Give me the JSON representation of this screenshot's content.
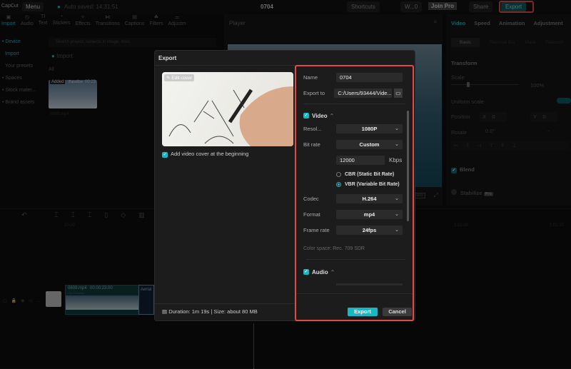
{
  "app": {
    "logo": "CapCut",
    "menu": "Menu",
    "autosave": "Auto saved: 14:31:51",
    "project_title": "0704",
    "shortcuts": "Shortcuts",
    "workspace": "W...0",
    "join_pro": "Join Pro",
    "share": "Share",
    "export": "Export"
  },
  "toolbar": [
    {
      "label": "Import",
      "icon": "import-icon"
    },
    {
      "label": "Audio",
      "icon": "audio-icon"
    },
    {
      "label": "Text",
      "icon": "text-icon"
    },
    {
      "label": "Stickers",
      "icon": "stickers-icon"
    },
    {
      "label": "Effects",
      "icon": "effects-icon"
    },
    {
      "label": "Transitions",
      "icon": "transitions-icon"
    },
    {
      "label": "Captions",
      "icon": "captions-icon"
    },
    {
      "label": "Filters",
      "icon": "filters-icon"
    },
    {
      "label": "Adjustm",
      "icon": "adjust-icon"
    }
  ],
  "sidebar": {
    "items": [
      "• Device",
      "Import",
      "Your presets",
      "• Spaces",
      "• Stock mater...",
      "• Brand assets"
    ]
  },
  "media": {
    "search_placeholder": "Search project, subjects in image, lines",
    "import": "Import",
    "filter": "All",
    "clip_badge": "Added",
    "clip_title": "Paradise",
    "clip_duration": "00:23",
    "clip_name": "0609.mp4"
  },
  "player": {
    "title": "Player",
    "ratio": "Ratio"
  },
  "right_panel": {
    "tabs": [
      "Video",
      "Speed",
      "Animation",
      "Adjustment"
    ],
    "subtabs": [
      "Basic",
      "Remove BG",
      "Mask",
      "Retouch"
    ],
    "transform": "Transform",
    "scale": "Scale",
    "scale_value": "100%",
    "scale_fraction": 0.1,
    "uniform_scale": "Uniform scale",
    "position": "Position",
    "pos_x_label": "X",
    "pos_x": "0",
    "pos_y_label": "Y",
    "pos_y": "0",
    "rotate": "Rotate",
    "rotate_value": "0.0°",
    "rotate_extra": "-",
    "blend": "Blend",
    "stabilize": "Stabilize",
    "pro_badge": "Pro"
  },
  "timeline": {
    "ticks": [
      "00:00",
      "1:02:00",
      "1:02:30"
    ],
    "clip1_name": "0609.mp4",
    "clip1_duration": "00:00:23:00",
    "clip1_sub": "Sky Paradise",
    "clip2_name": "Aerial"
  },
  "export_dialog": {
    "title": "Export",
    "edit_cover": "Edit cover",
    "add_cover": "Add video cover at the beginning",
    "name_label": "Name",
    "name_value": "0704",
    "export_to_label": "Export to",
    "export_to_value": "C:/Users/93444/Vide...",
    "video_section": "Video",
    "resolution_label": "Resol...",
    "resolution": "1080P",
    "bitrate_label": "Bit rate",
    "bitrate": "Custom",
    "kbps_value": "12000",
    "kbps_unit": "Kbps",
    "cbr": "CBR (Static Bit Rate)",
    "vbr": "VBR (Variable Bit Rate)",
    "codec_label": "Codec",
    "codec": "H.264",
    "format_label": "Format",
    "format": "mp4",
    "framerate_label": "Frame rate",
    "framerate": "24fps",
    "color_space": "Color space: Rec. 709 SDR",
    "audio_section": "Audio",
    "duration_info": "Duration: 1m 19s | Size: about 80 MB",
    "export_button": "Export",
    "cancel_button": "Cancel"
  },
  "colors": {
    "accent": "#19b6c4",
    "highlight": "#e24a4a",
    "background": "#0d0d0d",
    "dialog": "#1c1c1c"
  }
}
